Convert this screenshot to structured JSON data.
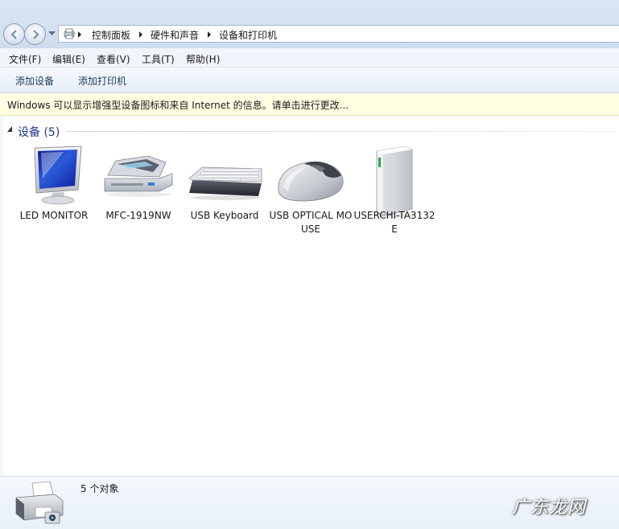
{
  "breadcrumb": [
    "控制面板",
    "硬件和声音",
    "设备和打印机"
  ],
  "menu": [
    "文件(F)",
    "编辑(E)",
    "查看(V)",
    "工具(T)",
    "帮助(H)"
  ],
  "commands": {
    "add_device": "添加设备",
    "add_printer": "添加打印机"
  },
  "infobar": {
    "text": "Windows 可以显示增强型设备图标和来自 Internet 的信息。请单击进行更改..."
  },
  "group": {
    "title": "设备 (5)"
  },
  "devices": [
    {
      "label": "LED MONITOR",
      "icon": "monitor-icon"
    },
    {
      "label": "MFC-1919NW",
      "icon": "scanner-printer-icon"
    },
    {
      "label": "USB Keyboard",
      "icon": "keyboard-icon"
    },
    {
      "label": "USB OPTICAL MOUSE",
      "icon": "mouse-icon"
    },
    {
      "label": "USERCHI-TA3132E",
      "icon": "external-drive-icon"
    }
  ],
  "details": {
    "count": "5 个对象",
    "icon": "devices-printers-icon"
  },
  "watermark": "广东龙网",
  "colors": {
    "group_title": "#1e3287",
    "infobar_bg": "#ffffe1",
    "command_text": "#1e395b"
  }
}
